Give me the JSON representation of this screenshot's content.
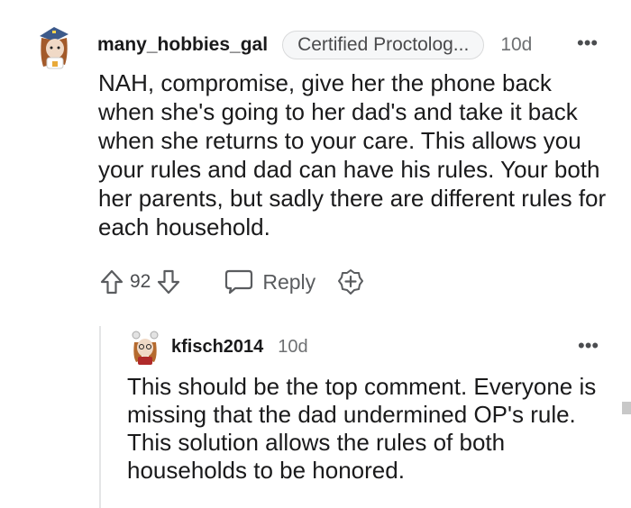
{
  "comment": {
    "username": "many_hobbies_gal",
    "flair": "Certified Proctolog...",
    "time": "10d",
    "more": "•••",
    "body": "NAH, compromise, give her the phone back when she's going to her dad's and take it back when she returns to your care. This allows you your rules and dad can have his rules. Your both her parents, but sadly there are different rules for each household.",
    "score": "92",
    "reply_label": "Reply",
    "icons": {
      "upvote": "upvote-arrow-icon",
      "downvote": "downvote-arrow-icon",
      "reply": "speech-bubble-icon",
      "award": "award-plus-icon"
    }
  },
  "reply": {
    "username": "kfisch2014",
    "time": "10d",
    "more": "•••",
    "body": "This should be the top comment. Everyone is missing that the dad undermined OP's rule. This solution allows the rules of both households to be honored."
  },
  "colors": {
    "text": "#1a1a1b",
    "meta": "#6e7072",
    "thread_line": "#e4e5e6",
    "flair_border": "#d9dadb"
  }
}
